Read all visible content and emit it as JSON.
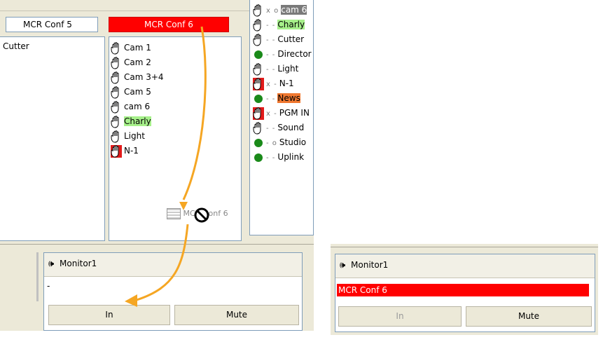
{
  "colors": {
    "accent_red": "#ff0000",
    "highlight_green": "#a6f08a",
    "highlight_orange": "#f07830",
    "arrow": "#f5a623"
  },
  "left_panel": {
    "conf_boxes": [
      "MCR Conf 5",
      "MCR Conf 6"
    ],
    "left_list_items": [
      "Cutter"
    ],
    "mcr_items": [
      {
        "label": "Cam 1",
        "icon": "hand-icon",
        "red": false,
        "highlight": null
      },
      {
        "label": "Cam 2",
        "icon": "hand-icon",
        "red": false,
        "highlight": null
      },
      {
        "label": "Cam 3+4",
        "icon": "hand-icon",
        "red": false,
        "highlight": null
      },
      {
        "label": "Cam 5",
        "icon": "hand-icon",
        "red": false,
        "highlight": null
      },
      {
        "label": "cam 6",
        "icon": "hand-icon",
        "red": false,
        "highlight": null
      },
      {
        "label": "Charly",
        "icon": "hand-icon",
        "red": false,
        "highlight": "green"
      },
      {
        "label": "Light",
        "icon": "hand-icon",
        "red": false,
        "highlight": null
      },
      {
        "label": "N-1",
        "icon": "hand-icon",
        "red": true,
        "highlight": null
      }
    ],
    "drag_label": "MCR Conf 6",
    "right_list": [
      {
        "label": "cam 6",
        "icon": "hand-icon",
        "mark": "x o",
        "highlight": "selected"
      },
      {
        "label": "Charly",
        "icon": "hand-icon",
        "mark": "- -",
        "highlight": "green"
      },
      {
        "label": "Cutter",
        "icon": "hand-icon",
        "mark": "- -",
        "highlight": null
      },
      {
        "label": "Director",
        "icon": "dot-icon",
        "mark": "- -",
        "highlight": null
      },
      {
        "label": "Light",
        "icon": "hand-icon",
        "mark": "- -",
        "highlight": null
      },
      {
        "label": "N-1",
        "icon": "hand-icon-red",
        "mark": "x -",
        "highlight": null
      },
      {
        "label": "News",
        "icon": "dot-icon",
        "mark": "- -",
        "highlight": "orange"
      },
      {
        "label": "PGM IN",
        "icon": "hand-icon-red",
        "mark": "x -",
        "highlight": null
      },
      {
        "label": "Sound",
        "icon": "hand-icon",
        "mark": "- -",
        "highlight": null
      },
      {
        "label": "Studio",
        "icon": "dot-icon",
        "mark": "- o",
        "highlight": null
      },
      {
        "label": "Uplink",
        "icon": "dot-icon",
        "mark": "- -",
        "highlight": null
      }
    ],
    "monitor": {
      "title": "Monitor1",
      "value": "-",
      "in_label": "In",
      "mute_label": "Mute"
    }
  },
  "right_panel": {
    "monitor": {
      "title": "Monitor1",
      "value": "MCR Conf 6",
      "in_label": "In",
      "mute_label": "Mute"
    }
  }
}
